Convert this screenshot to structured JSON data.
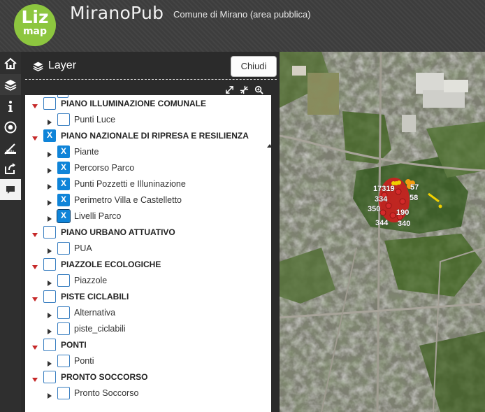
{
  "app": {
    "logo_line1": "Liz",
    "logo_line2": "map",
    "title": "MiranoPub",
    "subtitle": "Comune di Mirano (area pubblica)"
  },
  "toolbar": {
    "items": [
      "home-icon",
      "layers-icon",
      "info-icon",
      "locate-icon",
      "measure-icon",
      "share-icon",
      "message-icon"
    ]
  },
  "layer_panel": {
    "title": "Layer",
    "close_label": "Chiudi",
    "tools": [
      "expand-all-icon",
      "collapse-all-icon",
      "zoom-to-layer-icon"
    ],
    "tree": [
      {
        "type": "group",
        "label": "PIANO ILLUMINAZIONE COMUNALE",
        "checked": false
      },
      {
        "type": "layer",
        "label": "Punti Luce",
        "checked": false
      },
      {
        "type": "group",
        "label": "PIANO NAZIONALE DI RIPRESA E RESILIENZA",
        "checked": true
      },
      {
        "type": "layer",
        "label": "Piante",
        "checked": true
      },
      {
        "type": "layer",
        "label": "Percorso Parco",
        "checked": true
      },
      {
        "type": "layer",
        "label": "Punti Pozzetti e Illuninazione",
        "checked": true
      },
      {
        "type": "layer",
        "label": "Perimetro Villa e Castelletto",
        "checked": true
      },
      {
        "type": "layer",
        "label": "Livelli Parco",
        "checked": true,
        "focused": true
      },
      {
        "type": "group",
        "label": "PIANO URBANO ATTUATIVO",
        "checked": false
      },
      {
        "type": "layer",
        "label": "PUA",
        "checked": false
      },
      {
        "type": "group",
        "label": "PIAZZOLE ECOLOGICHE",
        "checked": false
      },
      {
        "type": "layer",
        "label": "Piazzole",
        "checked": false
      },
      {
        "type": "group",
        "label": "PISTE CICLABILI",
        "checked": false
      },
      {
        "type": "layer",
        "label": "Alternativa",
        "checked": false
      },
      {
        "type": "layer",
        "label": "piste_ciclabili",
        "checked": false
      },
      {
        "type": "group",
        "label": "PONTI",
        "checked": false
      },
      {
        "type": "layer",
        "label": "Ponti",
        "checked": false
      },
      {
        "type": "group",
        "label": "PRONTO SOCCORSO",
        "checked": false
      },
      {
        "type": "layer",
        "label": "Pronto Soccorso",
        "checked": false
      }
    ],
    "check_mark": "X"
  },
  "map": {
    "labels": [
      "17319",
      "57",
      "334",
      "58",
      "350",
      "190",
      "344",
      "340"
    ],
    "colors": {
      "points": "#cc1f1f",
      "highlight": "#f0d000",
      "orange": "#f39c12"
    }
  }
}
